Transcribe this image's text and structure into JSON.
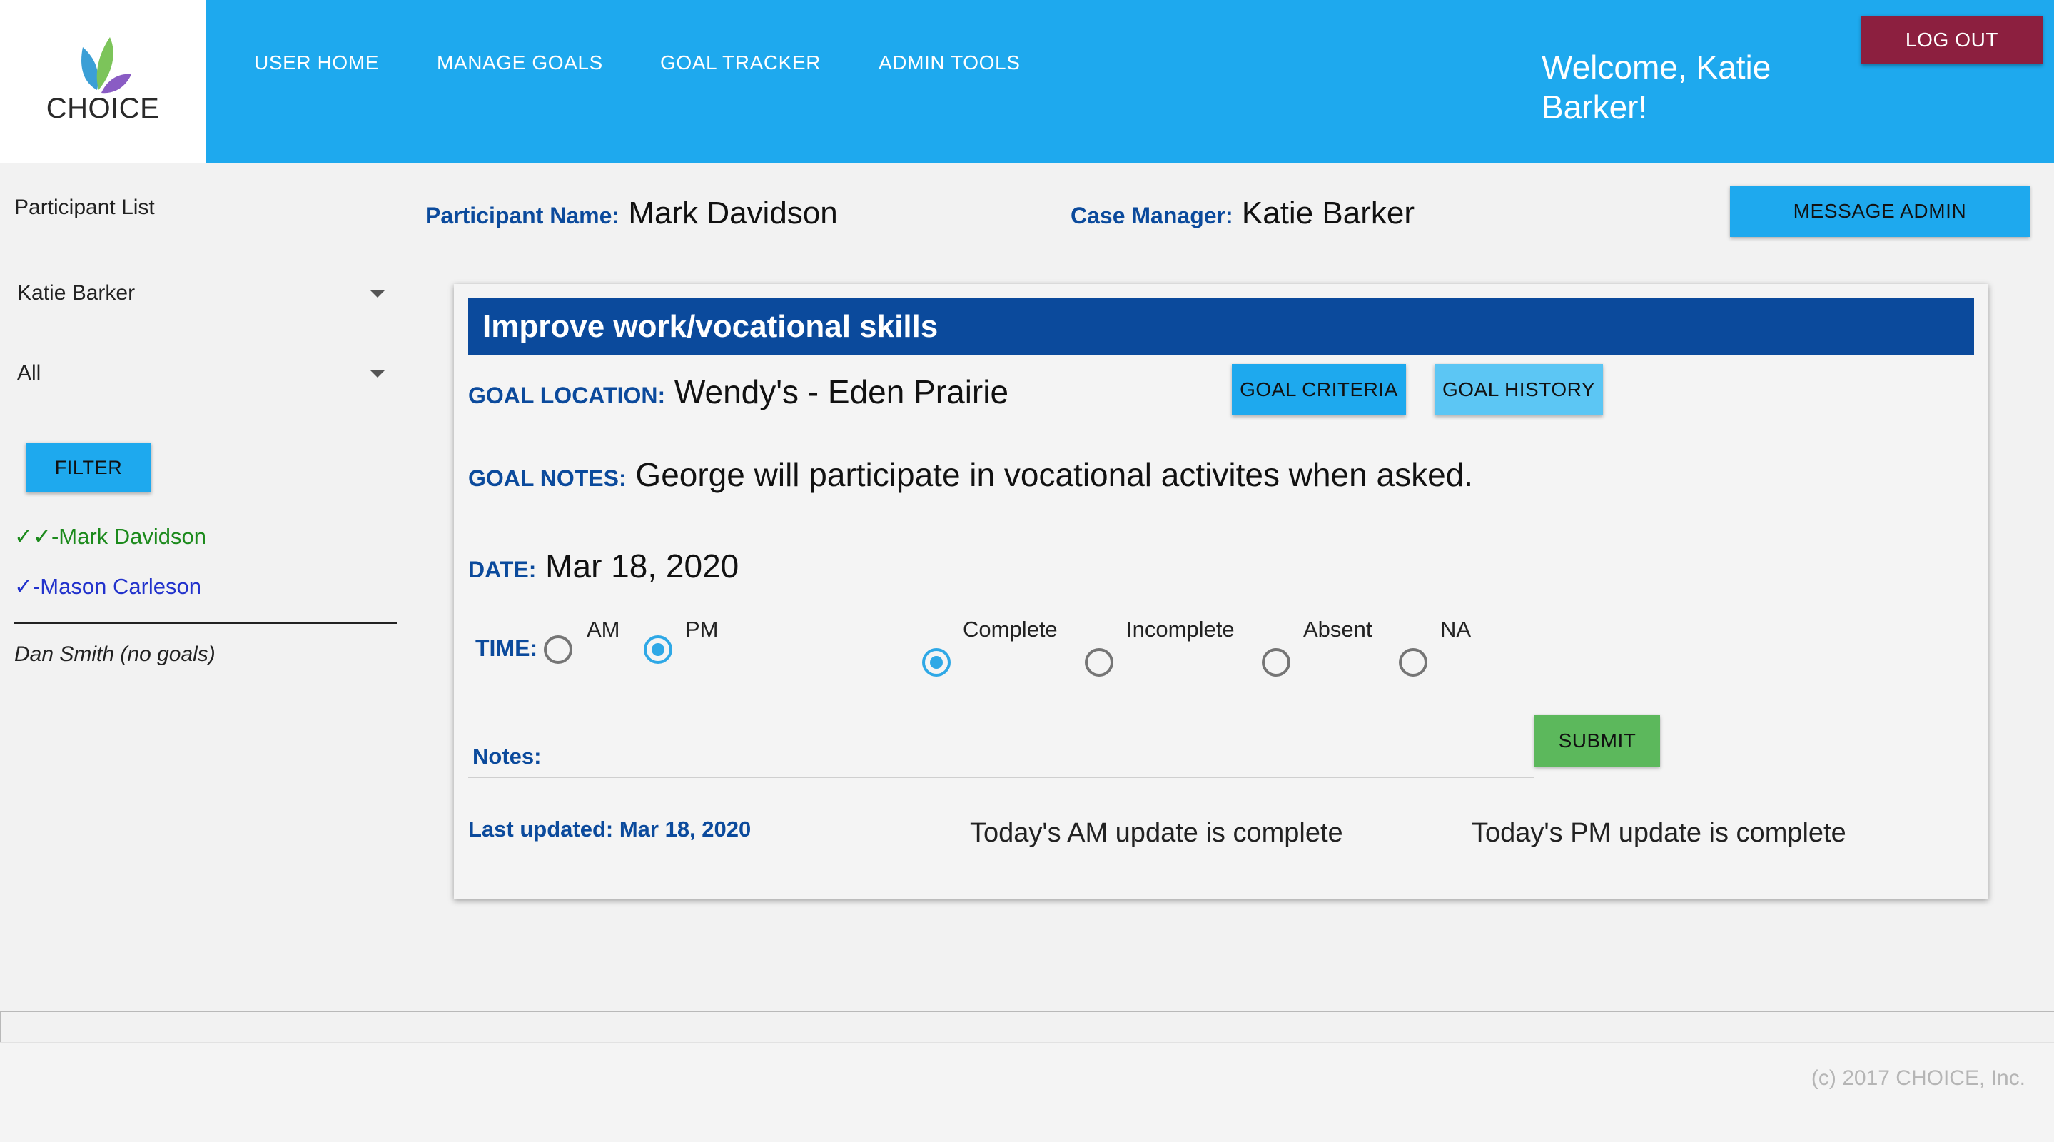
{
  "app": {
    "logo_text": "CHOICE"
  },
  "nav": {
    "items": [
      "USER HOME",
      "MANAGE GOALS",
      "GOAL TRACKER",
      "ADMIN TOOLS"
    ],
    "welcome": "Welcome, Katie Barker!",
    "logout_label": "LOG OUT"
  },
  "sidebar": {
    "title": "Participant List",
    "manager_select": "Katie Barker",
    "status_select": "All",
    "filter_label": "FILTER",
    "participants": [
      {
        "label": "✓✓-Mark Davidson",
        "color": "#1c8a1c"
      },
      {
        "label": "✓-Mason Carleson",
        "color": "#2232cc"
      }
    ],
    "no_goals": "Dan Smith (no goals)"
  },
  "header_info": {
    "participant_label": "Participant Name:",
    "participant_name": "Mark Davidson",
    "case_manager_label": "Case Manager:",
    "case_manager_name": "Katie Barker",
    "message_admin_label": "MESSAGE ADMIN"
  },
  "goal": {
    "title": "Improve work/vocational skills",
    "location_label": "GOAL LOCATION:",
    "location": "Wendy's - Eden Prairie",
    "criteria_label": "GOAL CRITERIA",
    "history_label": "GOAL HISTORY",
    "notes_label": "GOAL NOTES:",
    "notes": "George will participate in vocational activites when asked.",
    "date_label": "DATE:",
    "date": "Mar 18, 2020",
    "time_label": "TIME:",
    "time_options": [
      "AM",
      "PM"
    ],
    "time_selected": "PM",
    "status_options": [
      "Complete",
      "Incomplete",
      "Absent",
      "NA"
    ],
    "status_selected": "Complete",
    "entry_notes_label": "Notes:",
    "submit_label": "SUBMIT",
    "last_updated": "Last updated: Mar 18, 2020",
    "am_status": "Today's AM update is complete",
    "pm_status": "Today's PM update is complete"
  },
  "footer": {
    "copyright": "(c) 2017 CHOICE, Inc."
  },
  "colors": {
    "header_bg": "#1ea9ee",
    "logout_bg": "#8c1f3f",
    "goal_title_bg": "#0b4a9c",
    "label_blue": "#0b4a9c",
    "submit_green": "#5cb85c",
    "radio_selected": "#2ea8e6"
  },
  "icons": [
    "choice-leaf-logo-icon",
    "chevron-down-icon",
    "radio-button-icon"
  ]
}
